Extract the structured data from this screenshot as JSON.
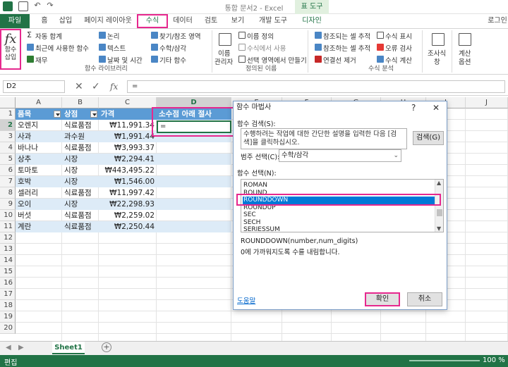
{
  "window": {
    "title": "통합 문서2 - Excel",
    "table_tools_label": "표 도구",
    "login_label": "로그인"
  },
  "tabs": {
    "file": "파일",
    "home": "홈",
    "insert": "삽입",
    "page_layout": "페이지 레이아웃",
    "formulas": "수식",
    "data": "데이터",
    "review": "검토",
    "view": "보기",
    "developer": "개발 도구",
    "design": "디자인"
  },
  "ribbon": {
    "insert_function": "함수\n삽입",
    "insert_function_line1": "함수",
    "insert_function_line2": "삽입",
    "autosum": "자동 합계",
    "recent": "최근에 사용한 함수",
    "financial": "재무",
    "logical": "논리",
    "text": "텍스트",
    "date_time": "날짜 및 시간",
    "lookup": "찾기/참조 영역",
    "math_trig": "수학/삼각",
    "more_functions": "기타 함수",
    "group_function_library": "함수 라이브러리",
    "name_manager_line1": "이름",
    "name_manager_line2": "관리자",
    "define_name": "이름 정의",
    "use_in_formula": "수식에서 사용",
    "create_from_selection": "선택 영역에서 만들기",
    "group_defined_names": "정의된 이름",
    "trace_precedents": "참조되는 셀 추적",
    "trace_dependents": "참조하는 셀 추적",
    "remove_arrows": "연결선 제거",
    "show_formulas": "수식 표시",
    "error_checking": "오류 검사",
    "evaluate_formula": "수식 계산",
    "group_formula_auditing": "수식 분석",
    "watch_window_line1": "조사식",
    "watch_window_line2": "창",
    "calc_options_line1": "계산",
    "calc_options_line2": "옵션"
  },
  "formula_bar": {
    "name_box": "D2",
    "fx": "fx",
    "content": "="
  },
  "grid": {
    "columns": [
      "A",
      "B",
      "C",
      "D",
      "E",
      "F",
      "G",
      "H",
      "I",
      "J"
    ],
    "rows": [
      "1",
      "2",
      "3",
      "4",
      "5",
      "6",
      "7",
      "8",
      "9",
      "10",
      "11",
      "12",
      "13",
      "14",
      "15",
      "16",
      "17",
      "18",
      "19",
      "20"
    ],
    "headers": [
      "품목",
      "상점",
      "가격",
      "소수점 아래 절사"
    ],
    "data": [
      [
        "오렌지",
        "식료품점",
        "₩11,991.34"
      ],
      [
        "사과",
        "과수원",
        "₩1,991.44"
      ],
      [
        "바나나",
        "식료품점",
        "₩3,993.37"
      ],
      [
        "상추",
        "시장",
        "₩2,294.41"
      ],
      [
        "토마토",
        "시장",
        "₩443,495.22"
      ],
      [
        "호박",
        "시장",
        "₩1,546.00"
      ],
      [
        "셀러리",
        "식료품점",
        "₩11,997.42"
      ],
      [
        "오이",
        "시장",
        "₩22,298.93"
      ],
      [
        "버섯",
        "식료품점",
        "₩2,259.02"
      ],
      [
        "계란",
        "식료품점",
        "₩2,250.44"
      ]
    ],
    "active_cell_value": "="
  },
  "sheets": {
    "sheet1": "Sheet1",
    "add": "+"
  },
  "status": {
    "mode": "편집",
    "zoom": "100 %"
  },
  "dialog": {
    "title": "함수 마법사",
    "help": "?",
    "close": "✕",
    "search_label": "함수 검색(S):",
    "search_text": "수행하려는 작업에 대한 간단한 설명을 입력한 다음 [검색]을 클릭하십시오.",
    "search_button": "검색(G)",
    "category_label": "범주 선택(C):",
    "category_value": "수학/삼각",
    "select_label": "함수 선택(N):",
    "functions": [
      "ROMAN",
      "ROUND",
      "ROUNDDOWN",
      "ROUNDUP",
      "SEC",
      "SECH",
      "SERIESSUM"
    ],
    "selected_function": "ROUNDDOWN",
    "signature": "ROUNDDOWN(number,num_digits)",
    "description": "0에 가까워지도록 수를 내림합니다.",
    "help_link": "도움말",
    "ok": "확인",
    "cancel": "취소"
  },
  "colors": {
    "excel_green": "#217346",
    "highlight_pink": "#e6288e",
    "table_header": "#5b9bd5",
    "table_band": "#ddebf7",
    "selection_blue": "#0078d7"
  }
}
